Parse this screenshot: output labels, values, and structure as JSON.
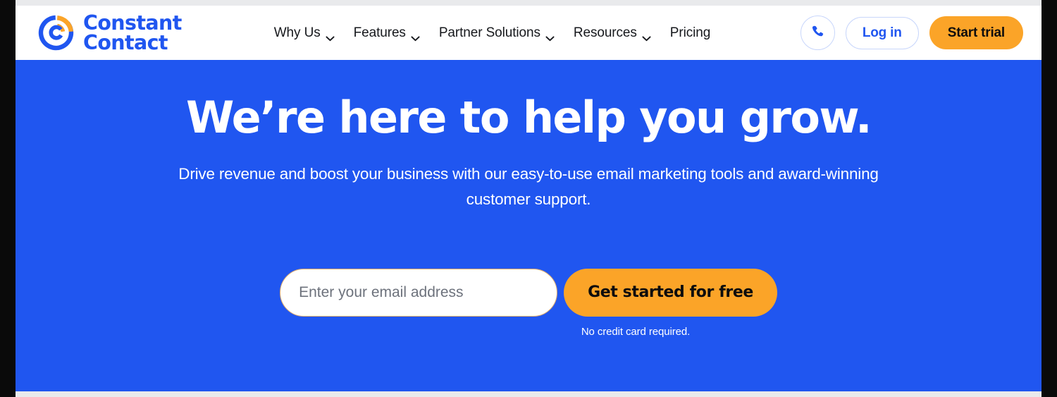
{
  "brand": {
    "name_line1": "Constant",
    "name_line2": "Contact",
    "logo_icon": "constant-contact-logo-icon",
    "blue": "#2056f0",
    "orange": "#fba428",
    "white": "#ffffff"
  },
  "header": {
    "nav": [
      {
        "label": "Why Us",
        "has_dropdown": true,
        "icon": "chevron-down-icon"
      },
      {
        "label": "Features",
        "has_dropdown": true,
        "icon": "chevron-down-icon"
      },
      {
        "label": "Partner Solutions",
        "has_dropdown": true,
        "icon": "chevron-down-icon"
      },
      {
        "label": "Resources",
        "has_dropdown": true,
        "icon": "chevron-down-icon"
      },
      {
        "label": "Pricing",
        "has_dropdown": false,
        "icon": ""
      }
    ],
    "phone_icon": "phone-icon",
    "login_label": "Log in",
    "trial_label": "Start trial"
  },
  "hero": {
    "title": "We’re here to help you grow.",
    "subtitle": "Drive revenue and boost your business with our easy-to-use email marketing tools and award-winning customer support.",
    "email_placeholder": "Enter your email address",
    "email_value": "",
    "cta_label": "Get started for free",
    "fineprint": "No credit card required."
  }
}
